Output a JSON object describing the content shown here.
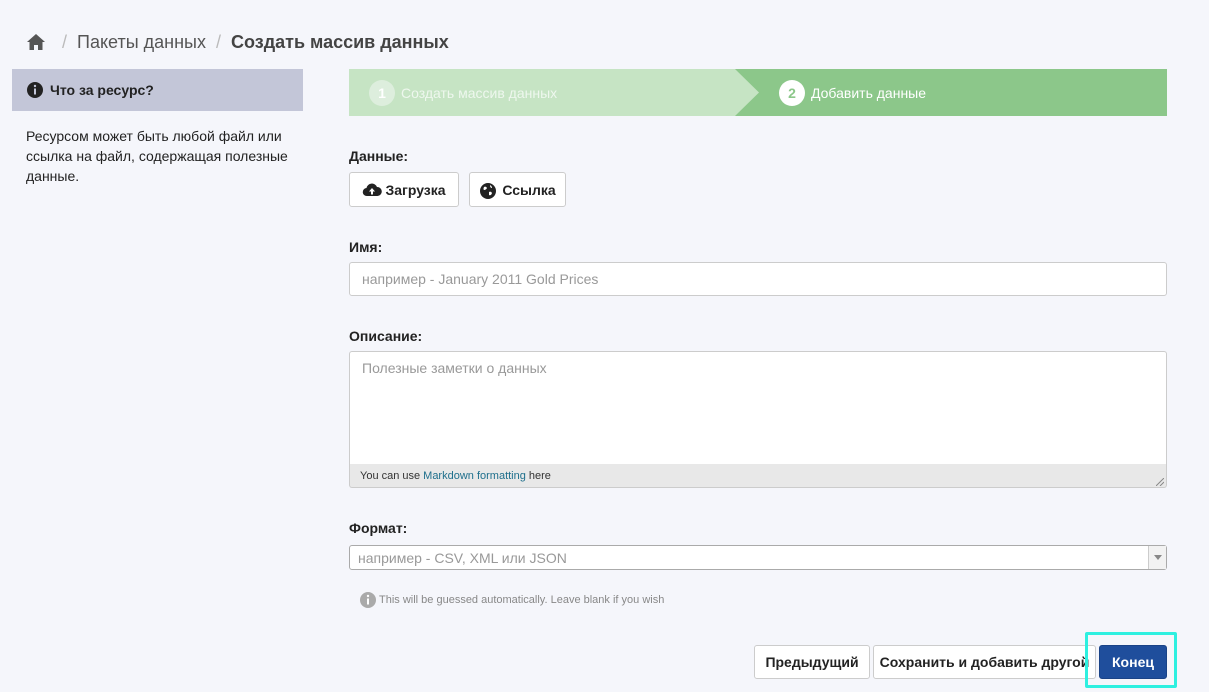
{
  "breadcrumb": {
    "home_icon": "home-icon",
    "separator": "/",
    "items": [
      "Пакеты данных"
    ],
    "current": "Создать массив данных"
  },
  "sidebar": {
    "icon": "info-circle-icon",
    "title": "Что за ресурс?",
    "body": "Ресурсом может быть любой файл или ссылка на файл, содержащая полезные данные."
  },
  "steps": [
    {
      "number": "1",
      "label": "Создать массив данных",
      "state": "done"
    },
    {
      "number": "2",
      "label": "Добавить данные",
      "state": "active"
    }
  ],
  "form": {
    "data_label": "Данные:",
    "upload_button": "Загрузка",
    "link_button": "Ссылка",
    "name_label": "Имя:",
    "name_value": "",
    "name_placeholder": "например - January 2011 Gold Prices",
    "description_label": "Описание:",
    "description_value": "",
    "description_placeholder": "Полезные заметки о данных",
    "markdown_prefix": "You can use",
    "markdown_link": "Markdown formatting",
    "markdown_suffix": "here",
    "format_label": "Формат:",
    "format_placeholder": "например - CSV, XML или JSON",
    "format_hint": "This will be guessed automatically. Leave blank if you wish"
  },
  "actions": {
    "previous": "Предыдущий",
    "save_add_another": "Сохранить и добавить другой",
    "finish": "Конец"
  },
  "colors": {
    "step_done": "#c6e4c4",
    "step_active": "#8cc78a",
    "primary_button": "#1f4e9c",
    "sidebar_header": "#c3c6d8",
    "focus_ring": "#2ef0e0"
  }
}
